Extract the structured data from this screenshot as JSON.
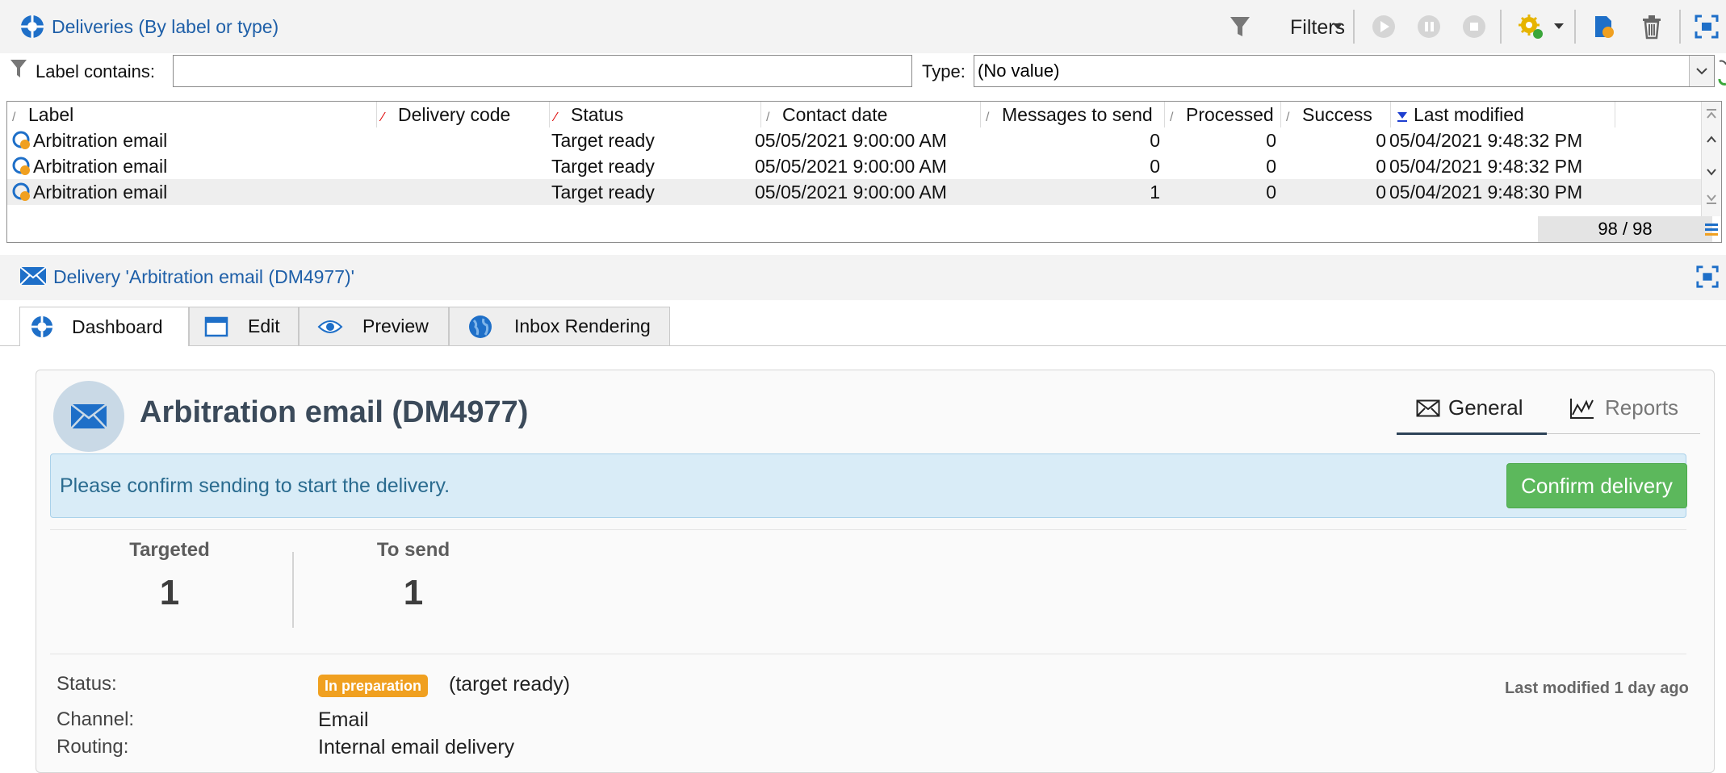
{
  "top": {
    "title": "Deliveries (By label or type)",
    "filters_label": "Filters"
  },
  "filter": {
    "label_contains": "Label contains:",
    "label_value": "",
    "type_label": "Type:",
    "type_value": "(No value)"
  },
  "grid": {
    "columns": [
      "Label",
      "Delivery code",
      "Status",
      "Contact date",
      "Messages to send",
      "Processed",
      "Success",
      "Last modified"
    ],
    "rows": [
      {
        "label": "Arbitration email",
        "code": "",
        "status": "Target ready",
        "contact": "05/05/2021 9:00:00 AM",
        "to_send": "0",
        "processed": "0",
        "success": "0",
        "modified": "05/04/2021 9:48:32 PM"
      },
      {
        "label": "Arbitration email",
        "code": "",
        "status": "Target ready",
        "contact": "05/05/2021 9:00:00 AM",
        "to_send": "0",
        "processed": "0",
        "success": "0",
        "modified": "05/04/2021 9:48:32 PM"
      },
      {
        "label": "Arbitration email",
        "code": "",
        "status": "Target ready",
        "contact": "05/05/2021 9:00:00 AM",
        "to_send": "1",
        "processed": "0",
        "success": "0",
        "modified": "05/04/2021 9:48:30 PM"
      }
    ],
    "count": "98 / 98"
  },
  "delivery": {
    "panel_title": "Delivery 'Arbitration email (DM4977)'",
    "tabs": [
      "Dashboard",
      "Edit",
      "Preview",
      "Inbox Rendering"
    ],
    "name": "Arbitration email (DM4977)",
    "subtab_general": "General",
    "subtab_reports": "Reports",
    "banner_text": "Please confirm sending to start the delivery.",
    "confirm_button": "Confirm delivery",
    "targeted_label": "Targeted",
    "targeted_value": "1",
    "tosend_label": "To send",
    "tosend_value": "1",
    "status_label": "Status:",
    "status_badge": "In preparation",
    "status_detail": "(target ready)",
    "last_modified": "Last modified 1 day ago",
    "channel_label": "Channel:",
    "channel_value": "Email",
    "routing_label": "Routing:",
    "routing_value": "Internal email delivery"
  },
  "colors": {
    "link_blue": "#1e5fa8",
    "confirm_green": "#5cb85c",
    "badge_orange": "#f0a020",
    "banner_blue": "#d9ecf7"
  }
}
